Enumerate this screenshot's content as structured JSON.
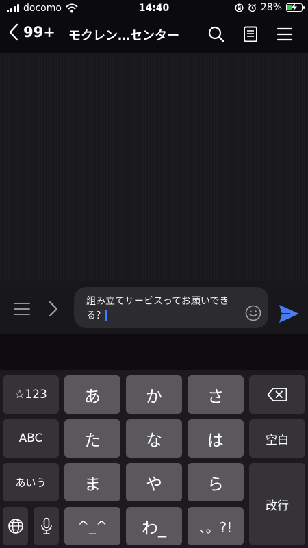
{
  "status_bar": {
    "carrier": "docomo",
    "time": "14:40",
    "battery_percent": "28%",
    "battery_level": 0.28,
    "icons": [
      "signal-icon",
      "wifi-icon",
      "orientation-lock-icon",
      "alarm-icon",
      "battery-charging-icon"
    ]
  },
  "header": {
    "back_count": "99+",
    "title": "モクレン…センター",
    "icons": [
      "back-chevron-icon",
      "search-icon",
      "notes-icon",
      "menu-icon"
    ]
  },
  "input_bar": {
    "message_text": "組み立てサービスってお願いできる？",
    "icons": [
      "menu-icon",
      "chevron-right-icon",
      "emoji-icon",
      "send-icon"
    ]
  },
  "keyboard": {
    "keys": {
      "numbers": "☆123",
      "a": "あ",
      "ka": "か",
      "sa": "さ",
      "ta": "た",
      "na": "な",
      "ha": "は",
      "ma": "ま",
      "ya": "や",
      "ra": "ら",
      "emoticon": "^_^",
      "wa": "わ_",
      "punct": "、。?!",
      "abc": "ABC",
      "aiu": "あいう",
      "space": "空白",
      "enter": "改行"
    },
    "icons": [
      "delete-icon",
      "globe-icon",
      "microphone-icon"
    ]
  },
  "colors": {
    "accent": "#3d7dff",
    "send": "#4a7cf0",
    "battery": "#2ecc40"
  }
}
